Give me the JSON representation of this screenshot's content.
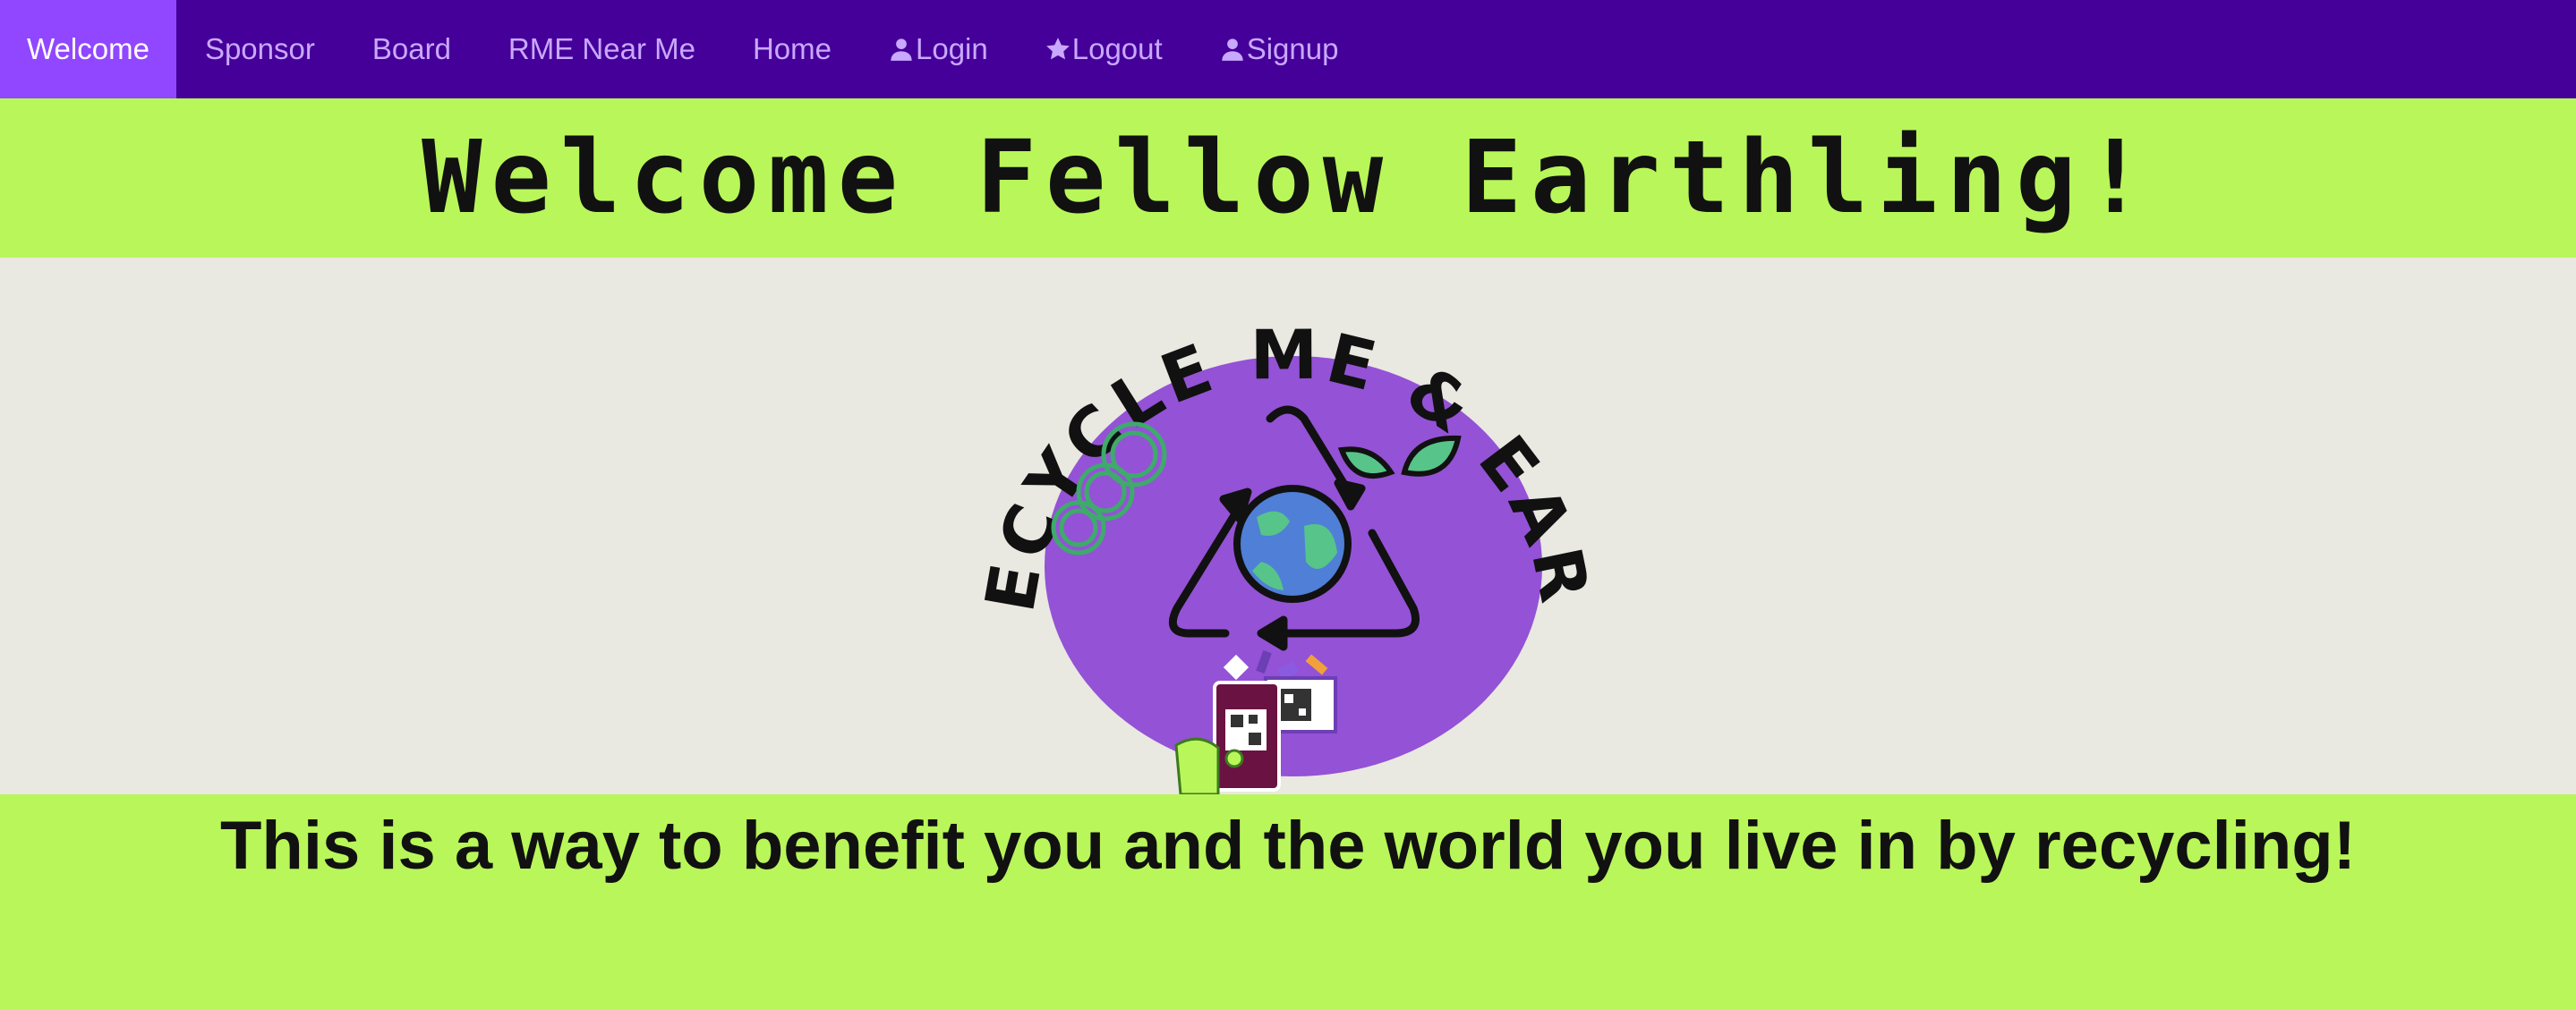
{
  "nav": {
    "items": [
      {
        "label": "Welcome",
        "active": true
      },
      {
        "label": "Sponsor"
      },
      {
        "label": "Board"
      },
      {
        "label": "RME Near Me"
      },
      {
        "label": "Home"
      },
      {
        "label": "Login",
        "icon": "user-icon"
      },
      {
        "label": "Logout",
        "icon": "star-icon"
      },
      {
        "label": "Signup",
        "icon": "user-icon"
      }
    ]
  },
  "header": {
    "title": "Welcome Fellow Earthling!"
  },
  "logo": {
    "text": "RECYCLE ME & EARN"
  },
  "main": {
    "tagline": "This is a way to benefit you and the world you live in by recycling!"
  },
  "colors": {
    "navbar": "#450099",
    "nav_active": "#9147ff",
    "nav_text": "#c9a8ff",
    "accent_green": "#b9f65a",
    "hero_bg": "#e9e8e1",
    "logo_purple": "#9452d6"
  }
}
